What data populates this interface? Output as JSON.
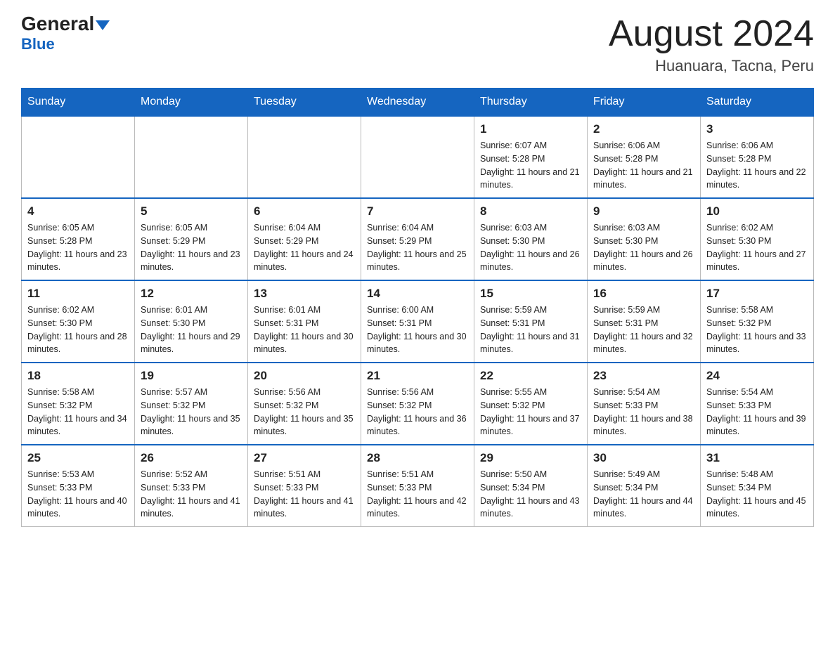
{
  "header": {
    "logo_general": "General",
    "logo_blue": "Blue",
    "month_title": "August 2024",
    "location": "Huanuara, Tacna, Peru"
  },
  "weekdays": [
    "Sunday",
    "Monday",
    "Tuesday",
    "Wednesday",
    "Thursday",
    "Friday",
    "Saturday"
  ],
  "weeks": [
    [
      {
        "day": "",
        "info": ""
      },
      {
        "day": "",
        "info": ""
      },
      {
        "day": "",
        "info": ""
      },
      {
        "day": "",
        "info": ""
      },
      {
        "day": "1",
        "info": "Sunrise: 6:07 AM\nSunset: 5:28 PM\nDaylight: 11 hours and 21 minutes."
      },
      {
        "day": "2",
        "info": "Sunrise: 6:06 AM\nSunset: 5:28 PM\nDaylight: 11 hours and 21 minutes."
      },
      {
        "day": "3",
        "info": "Sunrise: 6:06 AM\nSunset: 5:28 PM\nDaylight: 11 hours and 22 minutes."
      }
    ],
    [
      {
        "day": "4",
        "info": "Sunrise: 6:05 AM\nSunset: 5:28 PM\nDaylight: 11 hours and 23 minutes."
      },
      {
        "day": "5",
        "info": "Sunrise: 6:05 AM\nSunset: 5:29 PM\nDaylight: 11 hours and 23 minutes."
      },
      {
        "day": "6",
        "info": "Sunrise: 6:04 AM\nSunset: 5:29 PM\nDaylight: 11 hours and 24 minutes."
      },
      {
        "day": "7",
        "info": "Sunrise: 6:04 AM\nSunset: 5:29 PM\nDaylight: 11 hours and 25 minutes."
      },
      {
        "day": "8",
        "info": "Sunrise: 6:03 AM\nSunset: 5:30 PM\nDaylight: 11 hours and 26 minutes."
      },
      {
        "day": "9",
        "info": "Sunrise: 6:03 AM\nSunset: 5:30 PM\nDaylight: 11 hours and 26 minutes."
      },
      {
        "day": "10",
        "info": "Sunrise: 6:02 AM\nSunset: 5:30 PM\nDaylight: 11 hours and 27 minutes."
      }
    ],
    [
      {
        "day": "11",
        "info": "Sunrise: 6:02 AM\nSunset: 5:30 PM\nDaylight: 11 hours and 28 minutes."
      },
      {
        "day": "12",
        "info": "Sunrise: 6:01 AM\nSunset: 5:30 PM\nDaylight: 11 hours and 29 minutes."
      },
      {
        "day": "13",
        "info": "Sunrise: 6:01 AM\nSunset: 5:31 PM\nDaylight: 11 hours and 30 minutes."
      },
      {
        "day": "14",
        "info": "Sunrise: 6:00 AM\nSunset: 5:31 PM\nDaylight: 11 hours and 30 minutes."
      },
      {
        "day": "15",
        "info": "Sunrise: 5:59 AM\nSunset: 5:31 PM\nDaylight: 11 hours and 31 minutes."
      },
      {
        "day": "16",
        "info": "Sunrise: 5:59 AM\nSunset: 5:31 PM\nDaylight: 11 hours and 32 minutes."
      },
      {
        "day": "17",
        "info": "Sunrise: 5:58 AM\nSunset: 5:32 PM\nDaylight: 11 hours and 33 minutes."
      }
    ],
    [
      {
        "day": "18",
        "info": "Sunrise: 5:58 AM\nSunset: 5:32 PM\nDaylight: 11 hours and 34 minutes."
      },
      {
        "day": "19",
        "info": "Sunrise: 5:57 AM\nSunset: 5:32 PM\nDaylight: 11 hours and 35 minutes."
      },
      {
        "day": "20",
        "info": "Sunrise: 5:56 AM\nSunset: 5:32 PM\nDaylight: 11 hours and 35 minutes."
      },
      {
        "day": "21",
        "info": "Sunrise: 5:56 AM\nSunset: 5:32 PM\nDaylight: 11 hours and 36 minutes."
      },
      {
        "day": "22",
        "info": "Sunrise: 5:55 AM\nSunset: 5:32 PM\nDaylight: 11 hours and 37 minutes."
      },
      {
        "day": "23",
        "info": "Sunrise: 5:54 AM\nSunset: 5:33 PM\nDaylight: 11 hours and 38 minutes."
      },
      {
        "day": "24",
        "info": "Sunrise: 5:54 AM\nSunset: 5:33 PM\nDaylight: 11 hours and 39 minutes."
      }
    ],
    [
      {
        "day": "25",
        "info": "Sunrise: 5:53 AM\nSunset: 5:33 PM\nDaylight: 11 hours and 40 minutes."
      },
      {
        "day": "26",
        "info": "Sunrise: 5:52 AM\nSunset: 5:33 PM\nDaylight: 11 hours and 41 minutes."
      },
      {
        "day": "27",
        "info": "Sunrise: 5:51 AM\nSunset: 5:33 PM\nDaylight: 11 hours and 41 minutes."
      },
      {
        "day": "28",
        "info": "Sunrise: 5:51 AM\nSunset: 5:33 PM\nDaylight: 11 hours and 42 minutes."
      },
      {
        "day": "29",
        "info": "Sunrise: 5:50 AM\nSunset: 5:34 PM\nDaylight: 11 hours and 43 minutes."
      },
      {
        "day": "30",
        "info": "Sunrise: 5:49 AM\nSunset: 5:34 PM\nDaylight: 11 hours and 44 minutes."
      },
      {
        "day": "31",
        "info": "Sunrise: 5:48 AM\nSunset: 5:34 PM\nDaylight: 11 hours and 45 minutes."
      }
    ]
  ]
}
